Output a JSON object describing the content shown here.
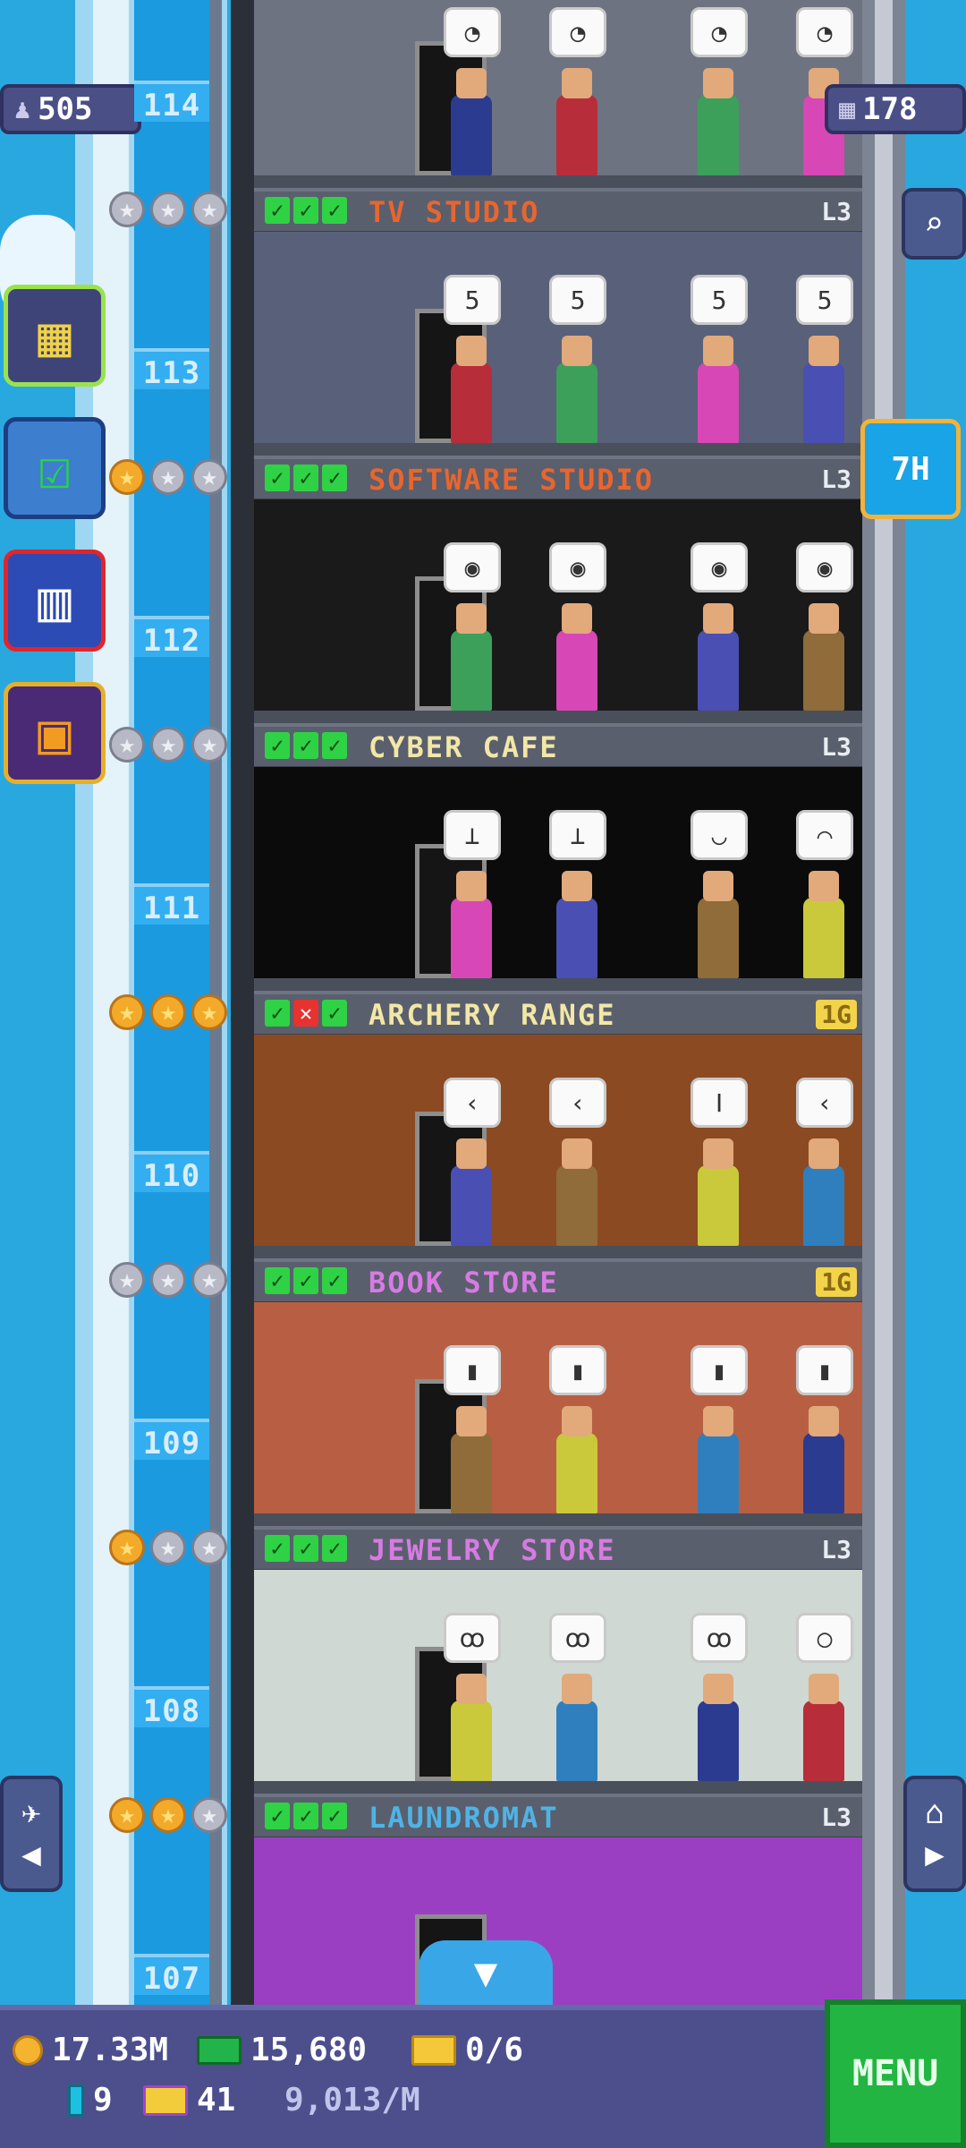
{
  "hud": {
    "population": "505",
    "floors_count": "178",
    "timer": "7H"
  },
  "floors": [
    {
      "number": "114",
      "name": "TV STUDIO",
      "level": "L3",
      "checks": [
        "ok",
        "ok",
        "ok"
      ],
      "stars": [
        "silver",
        "silver",
        "silver"
      ],
      "name_color": "#e8662e",
      "level_style": "plain",
      "wall": "#6e7382",
      "bubbles": [
        "◔",
        "◔",
        "◔",
        "◔"
      ]
    },
    {
      "number": "113",
      "name": "SOFTWARE STUDIO",
      "level": "L3",
      "checks": [
        "ok",
        "ok",
        "ok"
      ],
      "stars": [
        "gold",
        "silver",
        "silver"
      ],
      "name_color": "#e8662e",
      "level_style": "plain",
      "wall": "#59617a",
      "bubbles": [
        "5",
        "5",
        "5",
        "5"
      ]
    },
    {
      "number": "112",
      "name": "CYBER CAFE",
      "level": "L3",
      "checks": [
        "ok",
        "ok",
        "ok"
      ],
      "stars": [
        "silver",
        "silver",
        "silver"
      ],
      "name_color": "#f2e7a7",
      "level_style": "plain",
      "wall": "#1a1a1a",
      "bubbles": [
        "◉",
        "◉",
        "◉",
        "◉"
      ]
    },
    {
      "number": "111",
      "name": "ARCHERY RANGE",
      "level": "1G",
      "checks": [
        "ok",
        "x",
        "ok"
      ],
      "stars": [
        "gold",
        "gold",
        "gold"
      ],
      "name_color": "#f2e7a7",
      "level_style": "gold",
      "wall": "#0b0b0b",
      "bubbles": [
        "⊥",
        "⊥",
        "◡",
        "⌒"
      ]
    },
    {
      "number": "110",
      "name": "BOOK STORE",
      "level": "1G",
      "checks": [
        "ok",
        "ok",
        "ok"
      ],
      "stars": [
        "silver",
        "silver",
        "silver"
      ],
      "name_color": "#d77be3",
      "level_style": "gold",
      "wall": "#8b4a21",
      "bubbles": [
        "‹",
        "‹",
        "ǀ",
        "‹"
      ]
    },
    {
      "number": "109",
      "name": "JEWELRY STORE",
      "level": "L3",
      "checks": [
        "ok",
        "ok",
        "ok"
      ],
      "stars": [
        "gold",
        "silver",
        "silver"
      ],
      "name_color": "#d77be3",
      "level_style": "plain",
      "wall": "#b85f43",
      "bubbles": [
        "▮",
        "▮",
        "▮",
        "▮"
      ]
    },
    {
      "number": "108",
      "name": "LAUNDROMAT",
      "level": "L3",
      "checks": [
        "ok",
        "ok",
        "ok"
      ],
      "stars": [
        "gold",
        "gold",
        "silver"
      ],
      "name_color": "#4fb3e6",
      "level_style": "plain",
      "wall": "#cfd8d2",
      "bubbles": [
        "ꝏ",
        "ꝏ",
        "ꝏ",
        "○"
      ]
    },
    {
      "number": "107",
      "name": "",
      "level": "",
      "checks": [],
      "stars": [],
      "name_color": "#ffffff",
      "level_style": "plain",
      "wall": "#9b3fc2",
      "bubbles": []
    }
  ],
  "bottom": {
    "coins": "17.33M",
    "cash": "15,680",
    "tickets": "0/6",
    "bux": "9",
    "tv": "41",
    "rate": "9,013/M",
    "menu_label": "MENU"
  },
  "icons": {
    "population": "person-icon",
    "floors": "building-grid-icon",
    "search": "magnifier-icon",
    "left_nav": "elevator-left-icon",
    "right_nav": "home-right-icon",
    "down": "chevron-down-icon"
  }
}
